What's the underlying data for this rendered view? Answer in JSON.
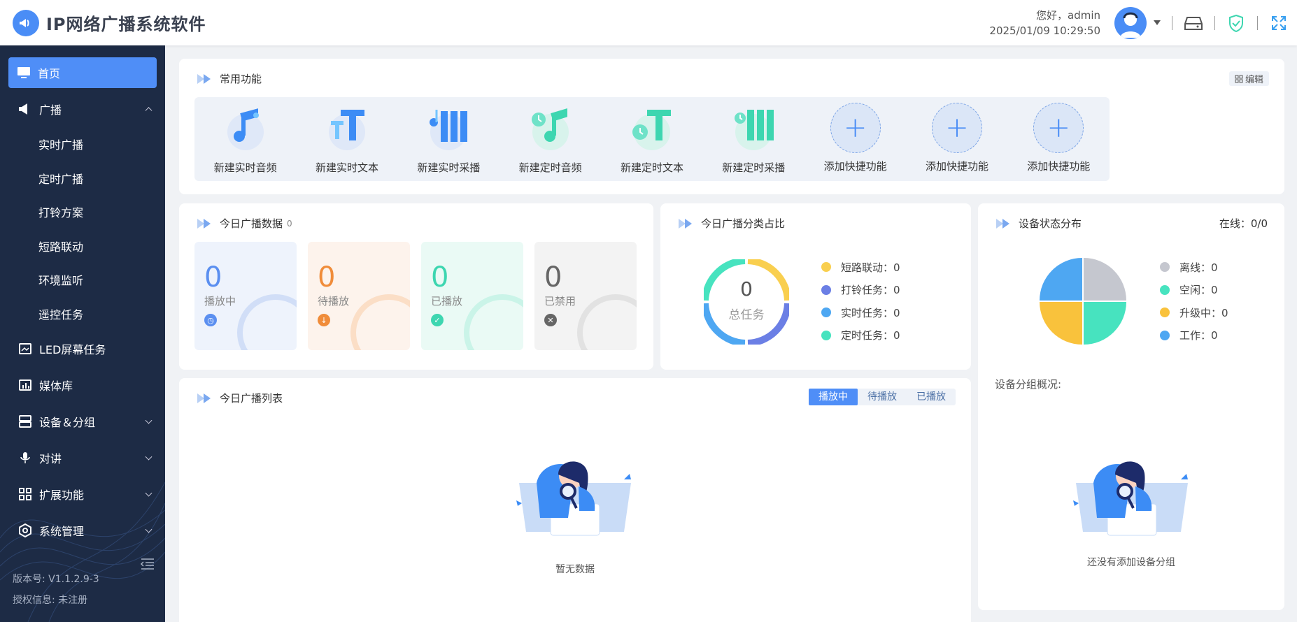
{
  "app": {
    "title": "IP网络广播系统软件"
  },
  "header": {
    "greeting": "您好，admin",
    "datetime": "2025/01/09 10:29:50"
  },
  "sidebar": {
    "items": [
      {
        "label": "首页",
        "icon": "monitor-icon",
        "active": true
      },
      {
        "label": "广播",
        "icon": "megaphone-icon",
        "expanded": true
      },
      {
        "label": "LED屏幕任务",
        "icon": "led-screen-icon"
      },
      {
        "label": "媒体库",
        "icon": "media-library-icon"
      },
      {
        "label": "设备＆分组",
        "icon": "device-group-icon"
      },
      {
        "label": "对讲",
        "icon": "microphone-icon"
      },
      {
        "label": "扩展功能",
        "icon": "grid-icon"
      },
      {
        "label": "系统管理",
        "icon": "settings-icon"
      }
    ],
    "broadcast_sub": [
      "实时广播",
      "定时广播",
      "打铃方案",
      "短路联动",
      "环境监听",
      "遥控任务"
    ],
    "version": "版本号: V1.1.2.9-3",
    "license": "授权信息: 未注册"
  },
  "quick": {
    "title": "常用功能",
    "edit_label": "编辑",
    "items": [
      {
        "label": "新建实时音频",
        "icon": "music-note-icon"
      },
      {
        "label": "新建实时文本",
        "icon": "text-icon"
      },
      {
        "label": "新建实时采播",
        "icon": "capture-icon"
      },
      {
        "label": "新建定时音频",
        "icon": "timed-music-icon"
      },
      {
        "label": "新建定时文本",
        "icon": "timed-text-icon"
      },
      {
        "label": "新建定时采播",
        "icon": "timed-capture-icon"
      },
      {
        "label": "添加快捷功能",
        "icon": "plus-icon"
      },
      {
        "label": "添加快捷功能",
        "icon": "plus-icon"
      },
      {
        "label": "添加快捷功能",
        "icon": "plus-icon"
      }
    ]
  },
  "today_data": {
    "title": "今日广播数据",
    "badge": "0",
    "stats": [
      {
        "value": "0",
        "label": "播放中",
        "color": "#5b8ff0",
        "bg": "#eef3fc"
      },
      {
        "value": "0",
        "label": "待播放",
        "color": "#f08c3a",
        "bg": "#fdf3ec"
      },
      {
        "value": "0",
        "label": "已播放",
        "color": "#3dd6b0",
        "bg": "#eafaf5"
      },
      {
        "value": "0",
        "label": "已禁用",
        "color": "#666666",
        "bg": "#f3f3f3"
      }
    ]
  },
  "category": {
    "title": "今日广播分类占比",
    "total_value": "0",
    "total_label": "总任务",
    "legend": [
      {
        "label": "短路联动：0",
        "color": "#f9cf4f"
      },
      {
        "label": "打铃任务：0",
        "color": "#6b7fe5"
      },
      {
        "label": "实时任务：0",
        "color": "#4ea7f2"
      },
      {
        "label": "定时任务：0",
        "color": "#47e3bf"
      }
    ]
  },
  "device": {
    "title": "设备状态分布",
    "online": "在线：0/0",
    "legend": [
      {
        "label": "离线：0",
        "color": "#c5c7cf"
      },
      {
        "label": "空闲：0",
        "color": "#47e3bf"
      },
      {
        "label": "升级中：0",
        "color": "#f9c23c"
      },
      {
        "label": "工作：0",
        "color": "#4ea7f2"
      }
    ],
    "group_title": "设备分组概况:",
    "group_empty": "还没有添加设备分组"
  },
  "list": {
    "title": "今日广播列表",
    "tabs": [
      "播放中",
      "待播放",
      "已播放"
    ],
    "empty": "暂无数据"
  }
}
